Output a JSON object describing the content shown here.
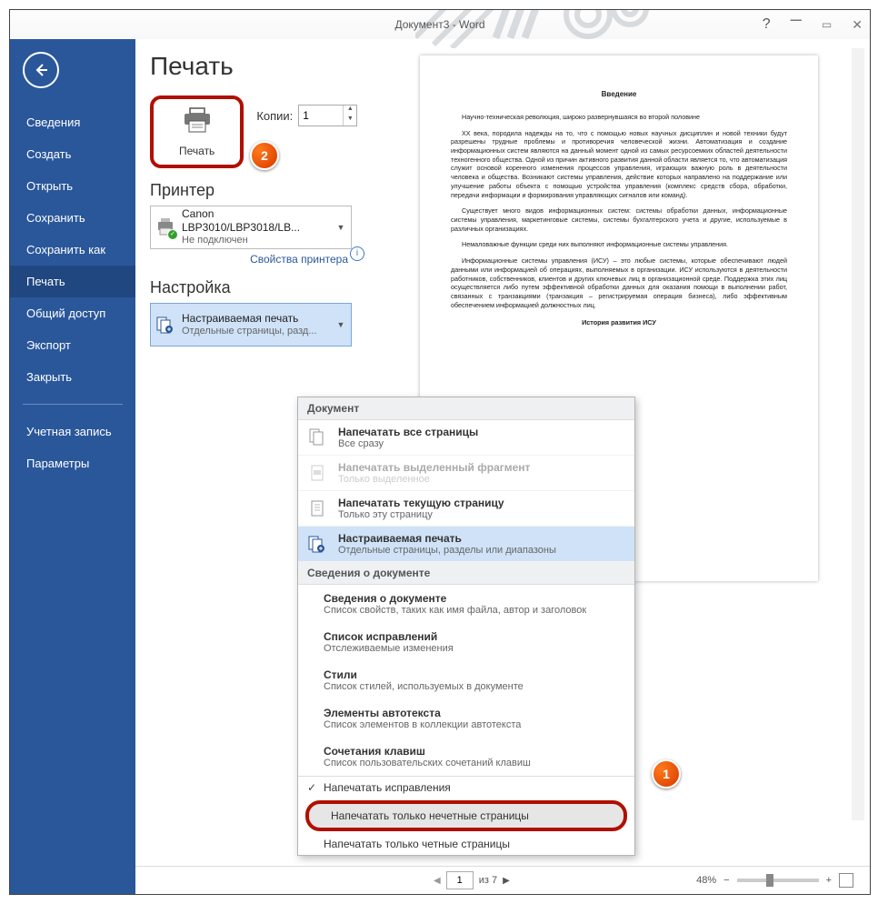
{
  "window": {
    "title": "Документ3 - Word"
  },
  "sidebar": {
    "items": [
      "Сведения",
      "Создать",
      "Открыть",
      "Сохранить",
      "Сохранить как",
      "Печать",
      "Общий доступ",
      "Экспорт",
      "Закрыть"
    ],
    "section2": [
      "Учетная запись",
      "Параметры"
    ],
    "selected": "Печать"
  },
  "print": {
    "heading": "Печать",
    "button_label": "Печать",
    "copies_label": "Копии:",
    "copies_value": "1",
    "printer_heading": "Принтер",
    "printer_name": "Canon LBP3010/LBP3018/LB...",
    "printer_status": "Не подключен",
    "printer_props_link": "Свойства принтера",
    "settings_heading": "Настройка",
    "current_setting_l1": "Настраиваемая печать",
    "current_setting_l2": "Отдельные страницы, разд..."
  },
  "dropdown": {
    "h1": "Документ",
    "items": [
      {
        "t1": "Напечатать все страницы",
        "t2": "Все сразу",
        "icon": "pages"
      },
      {
        "t1": "Напечатать выделенный фрагмент",
        "t2": "Только выделенное",
        "icon": "page-sel",
        "dis": true
      },
      {
        "t1": "Напечатать текущую страницу",
        "t2": "Только эту страницу",
        "icon": "page"
      },
      {
        "t1": "Настраиваемая печать",
        "t2": "Отдельные страницы, разделы или диапазоны",
        "icon": "pages-cfg",
        "sel": true
      }
    ],
    "h2": "Сведения о документе",
    "info_groups": [
      {
        "t1": "Сведения о документе",
        "t2": "Список свойств, таких как имя файла, автор и заголовок"
      },
      {
        "t1": "Список исправлений",
        "t2": "Отслеживаемые изменения"
      },
      {
        "t1": "Стили",
        "t2": "Список стилей, используемых в документе"
      },
      {
        "t1": "Элементы автотекста",
        "t2": "Список элементов в коллекции автотекста"
      },
      {
        "t1": "Сочетания клавиш",
        "t2": "Список пользовательских сочетаний клавиш"
      }
    ],
    "flat": [
      {
        "label": "Напечатать исправления",
        "check": true
      },
      {
        "label": "Напечатать только нечетные страницы",
        "red": true
      },
      {
        "label": "Напечатать только четные страницы"
      }
    ]
  },
  "preview": {
    "title": "Введение",
    "p1": "Научно-техническая революция, широко развернувшаяся во второй половине",
    "p2": "XX века, породила надежды на то, что с помощью новых научных дисциплин и новой техники будут разрешены трудные проблемы и противоречия человеческой жизни. Автоматизация и создание информационных систем являются на данный момент одной из самых ресурсоемких областей деятельности техногенного общества. Одной из причин активного развития данной области является то, что автоматизация служит основой коренного изменения процессов управления, играющих важную роль в деятельности человека и общества. Возникают системы управления, действие которых направлено на поддержание или улучшение работы объекта с помощью устройства управления (комплекс средств сбора, обработки, передачи информации и формирования управляющих сигналов или команд).",
    "p3": "Существует много видов информационных систем: системы обработки данных, информационные системы управления, маркетинговые системы, системы бухгалтерского учета и другие, используемые в различных организациях.",
    "p4": "Немаловажные функции среди них выполняют информационные системы управления.",
    "p5": "Информационные системы управления (ИСУ) – это любые системы, которые обеспечивают людей данными или информацией об операциях, выполняемых в организации. ИСУ используются в деятельности работников, собственников, клиентов и других ключевых лиц в организационной среде. Поддержка этих лиц осуществляется либо путем эффективной обработки данных для оказания помощи в выполнении работ, связанных с транзакциями (транзакция – регистрируемая операция бизнеса), либо эффективным обеспечением информацией должностных лиц.",
    "sect": "История развития ИСУ"
  },
  "statusbar": {
    "page_current": "1",
    "page_of_label": "из 7",
    "zoom": "48%"
  }
}
